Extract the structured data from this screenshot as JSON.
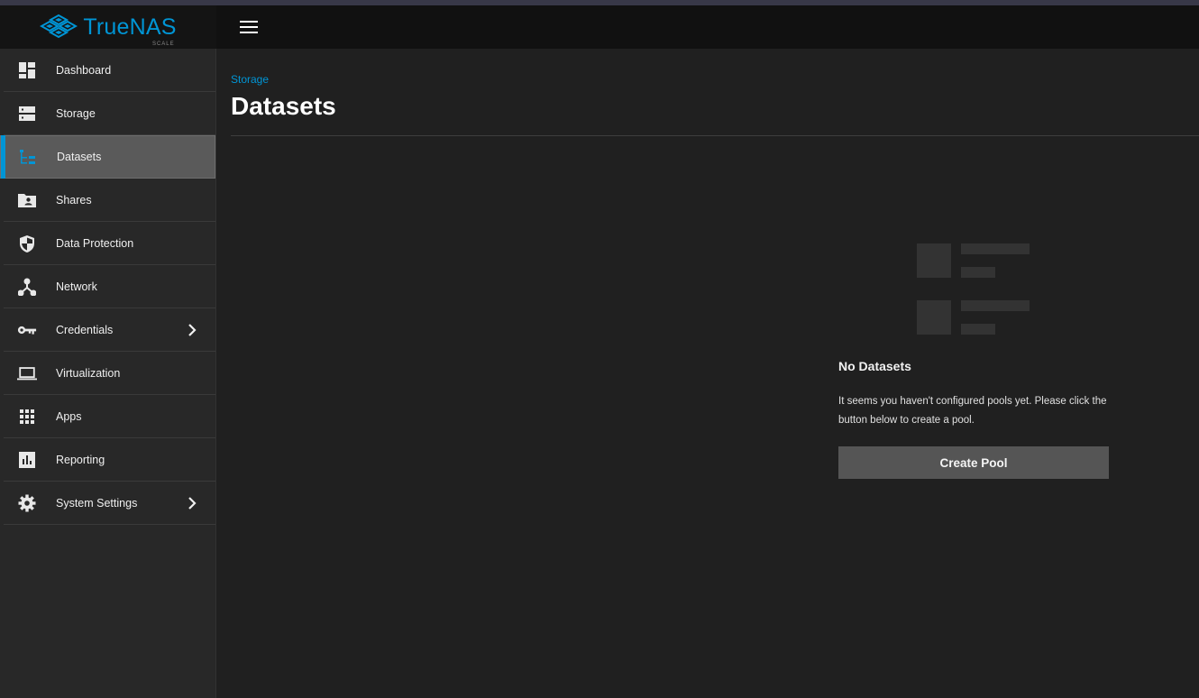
{
  "app": {
    "brand": "TrueNAS",
    "edition": "SCALE",
    "accent_color": "#0095d5"
  },
  "header": {
    "menu_icon": "hamburger-menu-icon"
  },
  "sidebar": {
    "items": [
      {
        "label": "Dashboard",
        "icon": "dashboard-icon",
        "active": false
      },
      {
        "label": "Storage",
        "icon": "storage-icon",
        "active": false
      },
      {
        "label": "Datasets",
        "icon": "datasets-icon",
        "active": true
      },
      {
        "label": "Shares",
        "icon": "shares-icon",
        "active": false
      },
      {
        "label": "Data Protection",
        "icon": "shield-icon",
        "active": false
      },
      {
        "label": "Network",
        "icon": "network-icon",
        "active": false
      },
      {
        "label": "Credentials",
        "icon": "key-icon",
        "active": false,
        "has_submenu": true
      },
      {
        "label": "Virtualization",
        "icon": "laptop-icon",
        "active": false
      },
      {
        "label": "Apps",
        "icon": "apps-grid-icon",
        "active": false
      },
      {
        "label": "Reporting",
        "icon": "reporting-chart-icon",
        "active": false
      },
      {
        "label": "System Settings",
        "icon": "gear-icon",
        "active": false,
        "has_submenu": true
      }
    ]
  },
  "main": {
    "breadcrumb": "Storage",
    "title": "Datasets",
    "empty_state": {
      "title": "No Datasets",
      "message": "It seems you haven't configured pools yet. Please click the button below to create a pool.",
      "button_label": "Create Pool"
    }
  }
}
